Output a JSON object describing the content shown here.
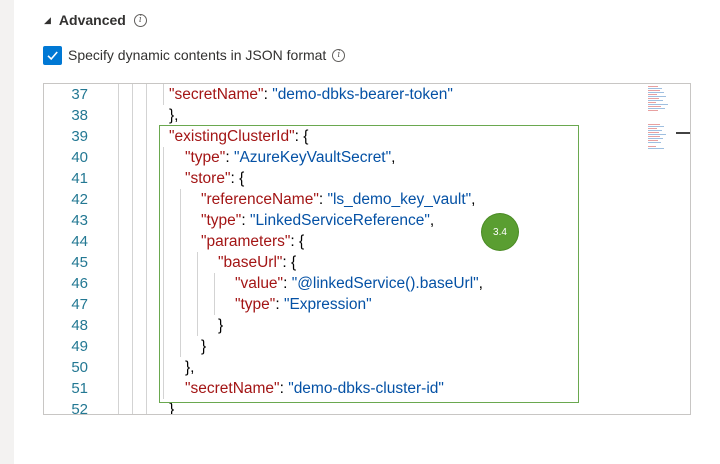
{
  "advanced": {
    "label": "Advanced"
  },
  "dynamic_contents": {
    "label": "Specify dynamic contents in JSON format",
    "checked": true
  },
  "editor": {
    "lines": [
      {
        "num": "37",
        "tokens": [
          [
            "k",
            "\"secretName\""
          ],
          [
            "p",
            ": "
          ],
          [
            "s",
            "\"demo-dbks-bearer-token\""
          ]
        ]
      },
      {
        "num": "38",
        "tokens": [
          [
            "p",
            "},"
          ]
        ]
      },
      {
        "num": "39",
        "tokens": [
          [
            "k",
            "\"existingClusterId\""
          ],
          [
            "p",
            ": {"
          ]
        ]
      },
      {
        "num": "40",
        "tokens": [
          [
            "k",
            "\"type\""
          ],
          [
            "p",
            ": "
          ],
          [
            "s",
            "\"AzureKeyVaultSecret\""
          ],
          [
            "p",
            ","
          ]
        ]
      },
      {
        "num": "41",
        "tokens": [
          [
            "k",
            "\"store\""
          ],
          [
            "p",
            ": {"
          ]
        ]
      },
      {
        "num": "42",
        "tokens": [
          [
            "k",
            "\"referenceName\""
          ],
          [
            "p",
            ": "
          ],
          [
            "s",
            "\"ls_demo_key_vault\""
          ],
          [
            "p",
            ","
          ]
        ]
      },
      {
        "num": "43",
        "tokens": [
          [
            "k",
            "\"type\""
          ],
          [
            "p",
            ": "
          ],
          [
            "s",
            "\"LinkedServiceReference\""
          ],
          [
            "p",
            ","
          ]
        ]
      },
      {
        "num": "44",
        "tokens": [
          [
            "k",
            "\"parameters\""
          ],
          [
            "p",
            ": {"
          ]
        ]
      },
      {
        "num": "45",
        "tokens": [
          [
            "k",
            "\"baseUrl\""
          ],
          [
            "p",
            ": {"
          ]
        ]
      },
      {
        "num": "46",
        "tokens": [
          [
            "k",
            "\"value\""
          ],
          [
            "p",
            ": "
          ],
          [
            "s",
            "\"@linkedService().baseUrl\""
          ],
          [
            "p",
            ","
          ]
        ]
      },
      {
        "num": "47",
        "tokens": [
          [
            "k",
            "\"type\""
          ],
          [
            "p",
            ": "
          ],
          [
            "s",
            "\"Expression\""
          ]
        ]
      },
      {
        "num": "48",
        "tokens": [
          [
            "p",
            "}"
          ]
        ]
      },
      {
        "num": "49",
        "tokens": [
          [
            "p",
            "}"
          ]
        ]
      },
      {
        "num": "50",
        "tokens": [
          [
            "p",
            "},"
          ]
        ]
      },
      {
        "num": "51",
        "tokens": [
          [
            "k",
            "\"secretName\""
          ],
          [
            "p",
            ": "
          ],
          [
            "s",
            "\"demo-dbks-cluster-id\""
          ]
        ]
      },
      {
        "num": "52",
        "tokens": [
          [
            "p",
            "}"
          ]
        ]
      }
    ]
  },
  "badge": {
    "label": "3.4",
    "color": "#5a9e31"
  },
  "colors": {
    "accent": "#0078d4",
    "key": "#a31515",
    "string": "#0451a5",
    "line_number": "#237893",
    "highlight": "#6aa84f"
  },
  "icons": {
    "expand": "triangle-down-icon",
    "info": "info-icon",
    "check": "checkmark-icon"
  }
}
